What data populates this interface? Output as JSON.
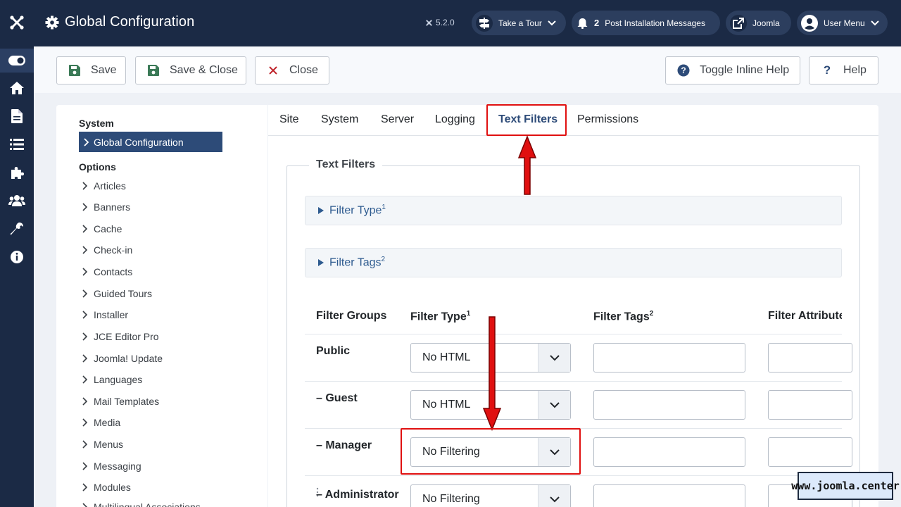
{
  "header": {
    "title": "Global Configuration",
    "version": "5.2.0",
    "tour_label": "Take a Tour",
    "messages_count": "2",
    "messages_label": "Post Installation Messages",
    "site_label": "Joomla",
    "user_label": "User Menu"
  },
  "toolbar": {
    "save_label": "Save",
    "save_close_label": "Save & Close",
    "close_label": "Close",
    "toggle_help_label": "Toggle Inline Help",
    "help_label": "Help"
  },
  "sidebar": {
    "system_heading": "System",
    "active_item": "Global Configuration",
    "options_heading": "Options",
    "items": [
      "Articles",
      "Banners",
      "Cache",
      "Check-in",
      "Contacts",
      "Guided Tours",
      "Installer",
      "JCE Editor Pro",
      "Joomla! Update",
      "Languages",
      "Mail Templates",
      "Media",
      "Menus",
      "Messaging",
      "Modules",
      "Multilingual Associations"
    ]
  },
  "tabs": [
    "Site",
    "System",
    "Server",
    "Logging",
    "Text Filters",
    "Permissions"
  ],
  "active_tab": "Text Filters",
  "fieldset": {
    "legend": "Text Filters",
    "accordion": [
      {
        "label": "Filter Type",
        "sup": "1"
      },
      {
        "label": "Filter Tags",
        "sup": "2"
      }
    ],
    "columns": [
      {
        "label": "Filter Groups",
        "sup": ""
      },
      {
        "label": "Filter Type",
        "sup": "1"
      },
      {
        "label": "Filter Tags",
        "sup": "2"
      },
      {
        "label": "Filter Attributes",
        "sup": ""
      }
    ],
    "rows": [
      {
        "group": "Public",
        "type": "No HTML"
      },
      {
        "group": "– Guest",
        "type": "No HTML"
      },
      {
        "group": "– Manager",
        "type": "No Filtering"
      },
      {
        "group": "– Administrator",
        "type": "No Filtering"
      }
    ]
  },
  "watermark": "www.joomla.center",
  "colors": {
    "navy": "#1b2a45",
    "accent": "#2d4b78",
    "annotation_red": "#e01010"
  }
}
